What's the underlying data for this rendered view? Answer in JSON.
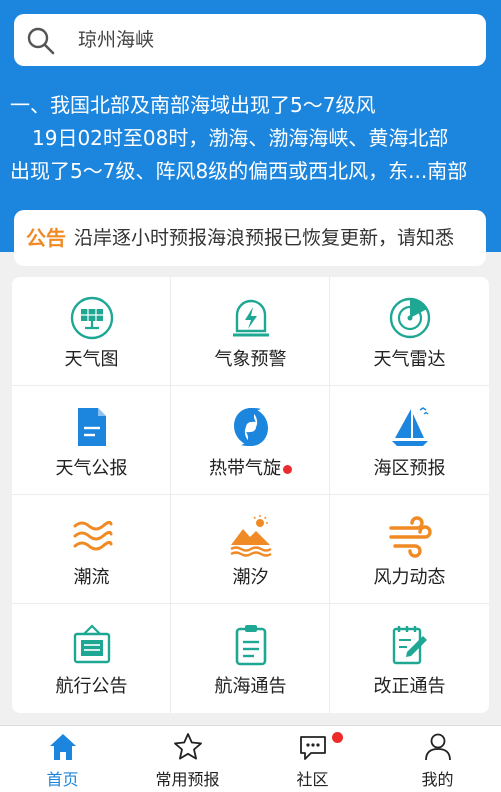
{
  "search": {
    "text": "琼州海峡"
  },
  "news": {
    "line1": "一、我国北部及南部海域出现了5～7级风",
    "line2": "19日02时至08时，渤海、渤海海峡、黄海北部",
    "line3": "出现了5～7级、阵风8级的偏西或西北风，东...南部"
  },
  "notice": {
    "tag": "公告",
    "text": "沿岸逐小时预报海浪预报已恢复更新，请知悉"
  },
  "grid": {
    "items": [
      {
        "label": "天气图",
        "icon": "solar-panel-icon"
      },
      {
        "label": "气象预警",
        "icon": "warning-lightning-icon"
      },
      {
        "label": "天气雷达",
        "icon": "radar-icon"
      },
      {
        "label": "天气公报",
        "icon": "document-icon"
      },
      {
        "label": "热带气旋",
        "icon": "typhoon-icon",
        "badge": true
      },
      {
        "label": "海区预报",
        "icon": "sailboat-icon"
      },
      {
        "label": "潮流",
        "icon": "current-waves-icon"
      },
      {
        "label": "潮汐",
        "icon": "tide-mountain-icon"
      },
      {
        "label": "风力动态",
        "icon": "wind-icon"
      },
      {
        "label": "航行公告",
        "icon": "notice-board-icon"
      },
      {
        "label": "航海通告",
        "icon": "clipboard-icon"
      },
      {
        "label": "改正通告",
        "icon": "edit-note-icon"
      }
    ]
  },
  "tabbar": {
    "tabs": [
      {
        "label": "首页",
        "icon": "home-icon",
        "active": true
      },
      {
        "label": "常用预报",
        "icon": "star-icon"
      },
      {
        "label": "社区",
        "icon": "chat-icon",
        "badge": true
      },
      {
        "label": "我的",
        "icon": "user-icon"
      }
    ]
  },
  "colors": {
    "primary": "#1c86de",
    "teal": "#1ea893",
    "blue": "#1c86de",
    "orange": "#f08a24",
    "badge": "#ee2b2b"
  }
}
